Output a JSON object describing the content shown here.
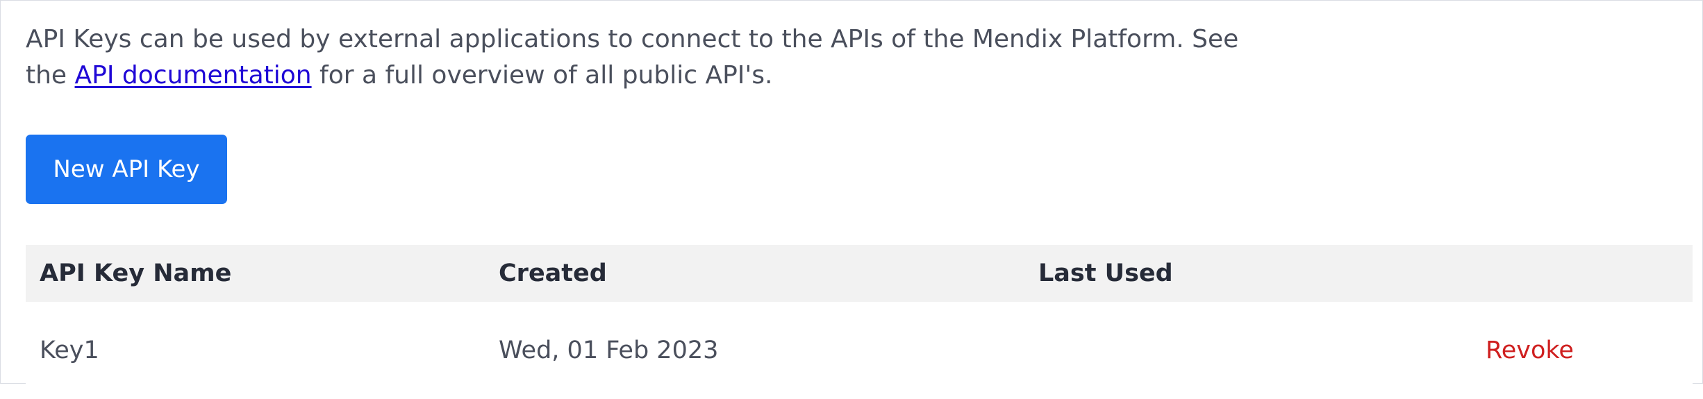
{
  "intro": {
    "text_before": "API Keys can be used by external applications to connect to the APIs of the Mendix Platform. See the ",
    "link_text": "API documentation",
    "text_after": " for a full overview of all public API's."
  },
  "actions": {
    "new_key_label": "New API Key"
  },
  "table": {
    "headers": {
      "name": "API Key Name",
      "created": "Created",
      "last_used": "Last Used"
    },
    "rows": [
      {
        "name": "Key1",
        "created": "Wed, 01 Feb 2023",
        "last_used": "",
        "action": "Revoke"
      }
    ]
  },
  "colors": {
    "primary": "#1a73f0",
    "link": "#1f07d6",
    "danger": "#cf1f1f",
    "header_bg": "#f2f2f2"
  }
}
